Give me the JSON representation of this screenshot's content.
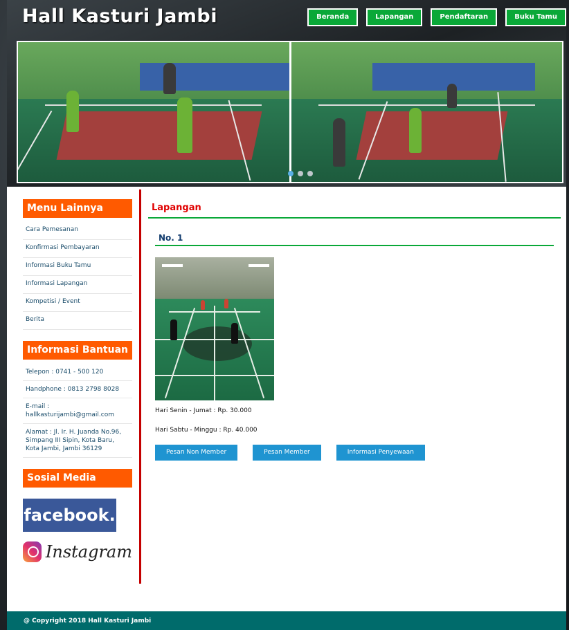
{
  "site": {
    "title": "Hall Kasturi Jambi"
  },
  "topnav": {
    "items": [
      {
        "label": "Beranda"
      },
      {
        "label": "Lapangan"
      },
      {
        "label": "Pendaftaran"
      },
      {
        "label": "Buku Tamu"
      }
    ]
  },
  "slider": {
    "active_index": 0,
    "count": 3
  },
  "sidebar": {
    "menu_title": "Menu Lainnya",
    "menu_items": [
      {
        "label": "Cara Pemesanan"
      },
      {
        "label": "Konfirmasi Pembayaran"
      },
      {
        "label": "Informasi Buku Tamu"
      },
      {
        "label": "Informasi Lapangan"
      },
      {
        "label": "Kompetisi / Event"
      },
      {
        "label": "Berita"
      }
    ],
    "info_title": "Informasi Bantuan",
    "info": {
      "telepon": "Telepon : 0741 - 500 120",
      "handphone": "Handphone : 0813 2798 8028",
      "email": "E-mail : hallkasturijambi@gmail.com",
      "alamat": "Alamat : Jl. Ir. H. Juanda No.96, Simpang III Sipin, Kota Baru, Kota Jambi, Jambi 36129"
    },
    "social_title": "Sosial Media",
    "facebook_label": "facebook.",
    "instagram_label": "Instagram"
  },
  "main": {
    "page_title": "Lapangan",
    "court_title": "No. 1",
    "price_weekday": "Hari Senin - Jumat : Rp. 30.000",
    "price_weekend": "Hari Sabtu - Minggu : Rp. 40.000",
    "buttons": {
      "non_member": "Pesan Non Member",
      "member": "Pesan Member",
      "info": "Informasi Penyewaan"
    }
  },
  "footer": {
    "copyright": "@ Copyright 2018 Hall Kasturi Jambi"
  },
  "colors": {
    "nav_green": "#0aa838",
    "sidebar_orange": "#ff5a00",
    "divider_red": "#c40000",
    "button_blue": "#1f94d1",
    "footer_teal": "#006b6b"
  }
}
